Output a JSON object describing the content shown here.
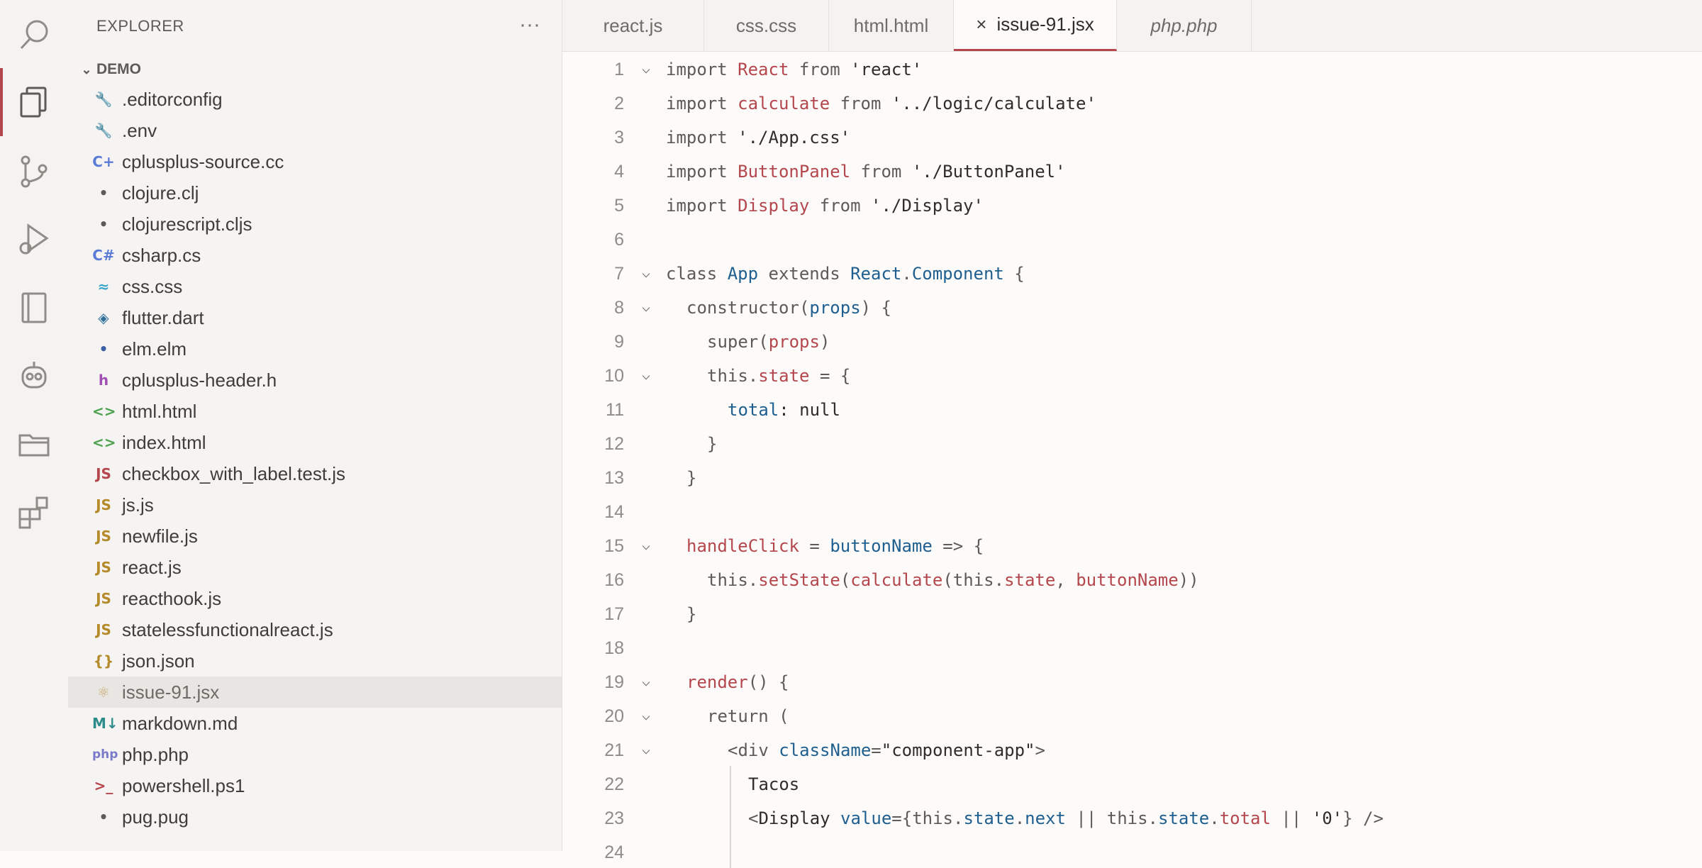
{
  "activity_bar": {
    "items": [
      {
        "icon": "search-icon"
      },
      {
        "icon": "files-icon"
      },
      {
        "icon": "source-control-icon"
      },
      {
        "icon": "run-debug-icon"
      },
      {
        "icon": "notebook-icon"
      },
      {
        "icon": "robot-icon"
      },
      {
        "icon": "folder-icon"
      },
      {
        "icon": "extensions-icon"
      }
    ],
    "accent": "#b4474d"
  },
  "sidebar": {
    "title": "EXPLORER",
    "more": "···",
    "section": "DEMO",
    "files": [
      {
        "name": ".editorconfig",
        "glyph": "🔧",
        "color": "#b4474d"
      },
      {
        "name": ".env",
        "glyph": "🔧",
        "color": "#b4474d"
      },
      {
        "name": "cplusplus-source.cc",
        "glyph": "C+",
        "color": "#5a7bd6"
      },
      {
        "name": "clojure.clj",
        "glyph": "•",
        "color": "#5d5a57"
      },
      {
        "name": "clojurescript.cljs",
        "glyph": "•",
        "color": "#5d5a57"
      },
      {
        "name": "csharp.cs",
        "glyph": "C#",
        "color": "#5a7bd6"
      },
      {
        "name": "css.css",
        "glyph": "≈",
        "color": "#37a6c9"
      },
      {
        "name": "flutter.dart",
        "glyph": "◈",
        "color": "#2e6f9a"
      },
      {
        "name": "elm.elm",
        "glyph": "•",
        "color": "#3c5fa8"
      },
      {
        "name": "cplusplus-header.h",
        "glyph": "h",
        "color": "#a14fb4"
      },
      {
        "name": "html.html",
        "glyph": "<>",
        "color": "#4da14f"
      },
      {
        "name": "index.html",
        "glyph": "<>",
        "color": "#4da14f"
      },
      {
        "name": "checkbox_with_label.test.js",
        "glyph": "JS",
        "color": "#b4474d"
      },
      {
        "name": "js.js",
        "glyph": "JS",
        "color": "#b58a2a"
      },
      {
        "name": "newfile.js",
        "glyph": "JS",
        "color": "#b58a2a"
      },
      {
        "name": "react.js",
        "glyph": "JS",
        "color": "#b58a2a"
      },
      {
        "name": "reacthook.js",
        "glyph": "JS",
        "color": "#b58a2a"
      },
      {
        "name": "statelessfunctionalreact.js",
        "glyph": "JS",
        "color": "#b58a2a"
      },
      {
        "name": "json.json",
        "glyph": "{}",
        "color": "#b58a2a"
      },
      {
        "name": "issue-91.jsx",
        "glyph": "⚛",
        "color": "#c9a86a",
        "selected": true
      },
      {
        "name": "markdown.md",
        "glyph": "M↓",
        "color": "#2e8b8b"
      },
      {
        "name": "php.php",
        "glyph": "php",
        "color": "#7a7ac9"
      },
      {
        "name": "powershell.ps1",
        "glyph": ">_",
        "color": "#b4474d"
      },
      {
        "name": "pug.pug",
        "glyph": "•",
        "color": "#5d5a57"
      }
    ]
  },
  "tabs": [
    {
      "label": "react.js"
    },
    {
      "label": "css.css"
    },
    {
      "label": "html.html"
    },
    {
      "label": "issue-91.jsx",
      "active": true,
      "close": "×"
    },
    {
      "label": "php.php",
      "italic": true
    }
  ],
  "code": {
    "lines": [
      {
        "n": "1",
        "fold": "⌵",
        "indent": 0,
        "tokens": [
          [
            "kw",
            "import "
          ],
          [
            "id",
            "React"
          ],
          [
            "kw",
            " from "
          ],
          [
            "st",
            "'react'"
          ]
        ]
      },
      {
        "n": "2",
        "indent": 0,
        "tokens": [
          [
            "kw",
            "import "
          ],
          [
            "id",
            "calculate"
          ],
          [
            "kw",
            " from "
          ],
          [
            "st",
            "'../logic/calculate'"
          ]
        ]
      },
      {
        "n": "3",
        "indent": 0,
        "tokens": [
          [
            "kw",
            "import "
          ],
          [
            "st",
            "'./App.css'"
          ]
        ]
      },
      {
        "n": "4",
        "indent": 0,
        "tokens": [
          [
            "kw",
            "import "
          ],
          [
            "id",
            "ButtonPanel"
          ],
          [
            "kw",
            " from "
          ],
          [
            "st",
            "'./ButtonPanel'"
          ]
        ]
      },
      {
        "n": "5",
        "indent": 0,
        "tokens": [
          [
            "kw",
            "import "
          ],
          [
            "id",
            "Display"
          ],
          [
            "kw",
            " from "
          ],
          [
            "st",
            "'./Display'"
          ]
        ]
      },
      {
        "n": "6",
        "indent": 0,
        "tokens": []
      },
      {
        "n": "7",
        "fold": "⌵",
        "indent": 0,
        "tokens": [
          [
            "kw",
            "class "
          ],
          [
            "ty",
            "App"
          ],
          [
            "kw",
            " extends "
          ],
          [
            "ty",
            "React"
          ],
          [
            "kw",
            "."
          ],
          [
            "ty",
            "Component"
          ],
          [
            "kw",
            " {"
          ]
        ]
      },
      {
        "n": "8",
        "fold": "⌵",
        "indent": 1,
        "tokens": [
          [
            "kw",
            "constructor("
          ],
          [
            "pr",
            "props"
          ],
          [
            "kw",
            ") {"
          ]
        ]
      },
      {
        "n": "9",
        "indent": 2,
        "tokens": [
          [
            "kw",
            "super("
          ],
          [
            "id",
            "props"
          ],
          [
            "kw",
            ")"
          ]
        ]
      },
      {
        "n": "10",
        "fold": "⌵",
        "indent": 2,
        "tokens": [
          [
            "kw",
            "this."
          ],
          [
            "id",
            "state"
          ],
          [
            "kw",
            " = {"
          ]
        ]
      },
      {
        "n": "11",
        "indent": 3,
        "tokens": [
          [
            "pr",
            "total"
          ],
          [
            "st",
            ": null"
          ]
        ]
      },
      {
        "n": "12",
        "indent": 2,
        "tokens": [
          [
            "kw",
            "}"
          ]
        ]
      },
      {
        "n": "13",
        "indent": 1,
        "tokens": [
          [
            "kw",
            "}"
          ]
        ]
      },
      {
        "n": "14",
        "indent": 0,
        "tokens": []
      },
      {
        "n": "15",
        "fold": "⌵",
        "indent": 1,
        "tokens": [
          [
            "fn",
            "handleClick"
          ],
          [
            "kw",
            " = "
          ],
          [
            "pr",
            "buttonName"
          ],
          [
            "kw",
            " => {"
          ]
        ]
      },
      {
        "n": "16",
        "indent": 2,
        "tokens": [
          [
            "kw",
            "this."
          ],
          [
            "fn",
            "setState"
          ],
          [
            "kw",
            "("
          ],
          [
            "fn",
            "calculate"
          ],
          [
            "kw",
            "(this."
          ],
          [
            "id",
            "state"
          ],
          [
            "kw",
            ", "
          ],
          [
            "id",
            "buttonName"
          ],
          [
            "kw",
            "))"
          ]
        ]
      },
      {
        "n": "17",
        "indent": 1,
        "tokens": [
          [
            "kw",
            "}"
          ]
        ]
      },
      {
        "n": "18",
        "indent": 0,
        "tokens": []
      },
      {
        "n": "19",
        "fold": "⌵",
        "indent": 1,
        "tokens": [
          [
            "fn",
            "render"
          ],
          [
            "kw",
            "() {"
          ]
        ]
      },
      {
        "n": "20",
        "fold": "⌵",
        "indent": 2,
        "tokens": [
          [
            "kw",
            "return ("
          ]
        ]
      },
      {
        "n": "21",
        "fold": "⌵",
        "indent": 3,
        "tokens": [
          [
            "kw",
            "<div "
          ],
          [
            "pr",
            "className"
          ],
          [
            "kw",
            "="
          ],
          [
            "st",
            "\"component-app\""
          ],
          [
            "kw",
            ">"
          ]
        ]
      },
      {
        "n": "22",
        "indent": 4,
        "guide": true,
        "tokens": [
          [
            "st",
            "Tacos"
          ]
        ]
      },
      {
        "n": "23",
        "indent": 4,
        "guide": true,
        "tokens": [
          [
            "kw",
            "<"
          ],
          [
            "st",
            "Display "
          ],
          [
            "pr",
            "value"
          ],
          [
            "kw",
            "={this."
          ],
          [
            "pr",
            "state"
          ],
          [
            "kw",
            "."
          ],
          [
            "pr",
            "next"
          ],
          [
            "kw",
            " || this."
          ],
          [
            "pr",
            "state"
          ],
          [
            "kw",
            "."
          ],
          [
            "id",
            "total"
          ],
          [
            "kw",
            " || "
          ],
          [
            "st",
            "'0'"
          ],
          [
            "kw",
            "} />"
          ]
        ]
      },
      {
        "n": "24",
        "indent": 4,
        "guide": true,
        "tokens": []
      }
    ]
  }
}
